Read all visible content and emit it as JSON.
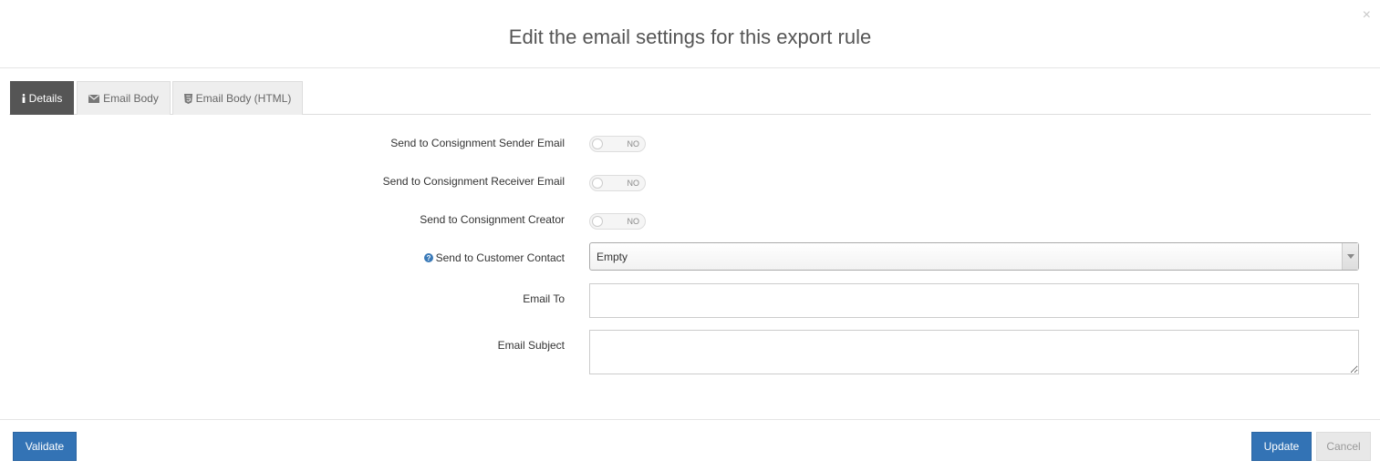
{
  "modal": {
    "title": "Edit the email settings for this export rule",
    "close_glyph": "×"
  },
  "tabs": [
    {
      "label": "Details",
      "icon": "info-icon",
      "active": true
    },
    {
      "label": "Email Body",
      "icon": "envelope-icon",
      "active": false
    },
    {
      "label": "Email Body (HTML)",
      "icon": "html5-icon",
      "active": false
    }
  ],
  "form": {
    "sender_email": {
      "label": "Send to Consignment Sender Email",
      "state": "NO"
    },
    "receiver_email": {
      "label": "Send to Consignment Receiver Email",
      "state": "NO"
    },
    "creator": {
      "label": "Send to Consignment Creator",
      "state": "NO"
    },
    "customer_contact": {
      "label": "Send to Customer Contact",
      "value": "Empty",
      "help_icon": "question-circle-icon"
    },
    "email_to": {
      "label": "Email To",
      "value": ""
    },
    "email_subject": {
      "label": "Email Subject",
      "value": ""
    }
  },
  "footer": {
    "validate_label": "Validate",
    "update_label": "Update",
    "cancel_label": "Cancel"
  },
  "colors": {
    "primary": "#3373b5",
    "active_tab": "#555555",
    "help_icon": "#3a7ab8"
  }
}
